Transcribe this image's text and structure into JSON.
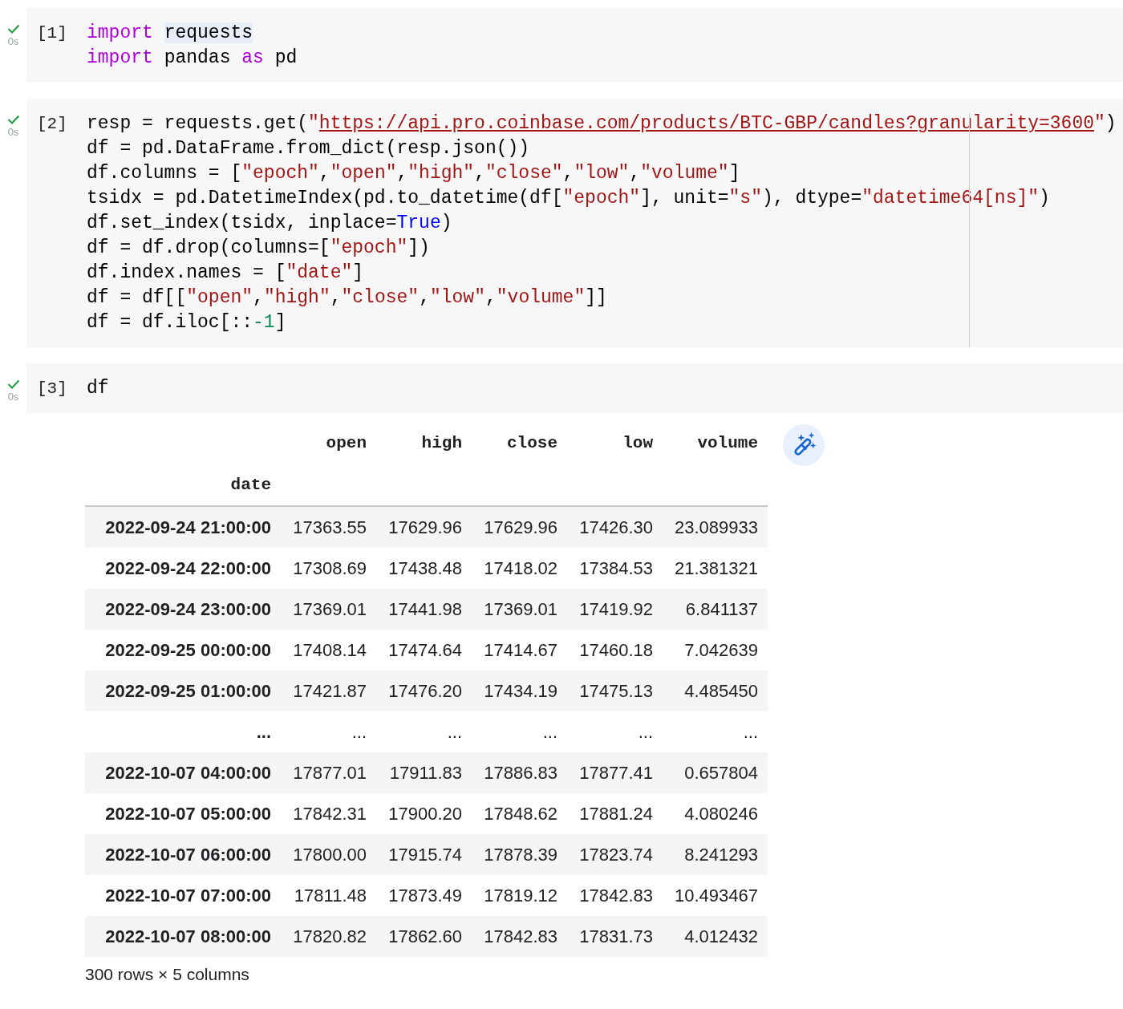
{
  "cells": [
    {
      "count": "[1]",
      "succeeded": true,
      "time": "0s",
      "lines": [
        [
          {
            "kind": "keyword",
            "text": "import "
          },
          {
            "kind": "match",
            "text": "requests"
          }
        ],
        [
          {
            "kind": "keyword",
            "text": "import"
          },
          {
            "kind": "plain",
            "text": " pandas "
          },
          {
            "kind": "keyword",
            "text": "as"
          },
          {
            "kind": "plain",
            "text": " pd"
          }
        ]
      ]
    },
    {
      "count": "[2]",
      "succeeded": true,
      "time": "0s",
      "lines": [
        [
          {
            "kind": "plain",
            "text": "resp = requests.get("
          },
          {
            "kind": "string",
            "text": "\""
          },
          {
            "kind": "link",
            "text": "https://api.pro.coinbase.com/products/BTC-GBP/candles?granularity=3600"
          },
          {
            "kind": "string",
            "text": "\""
          },
          {
            "kind": "plain",
            "text": ")"
          }
        ],
        [
          {
            "kind": "plain",
            "text": "df = pd.DataFrame.from_dict(resp.json())"
          }
        ],
        [
          {
            "kind": "plain",
            "text": "df.columns = ["
          },
          {
            "kind": "string",
            "text": "\"epoch\""
          },
          {
            "kind": "plain",
            "text": ","
          },
          {
            "kind": "string",
            "text": "\"open\""
          },
          {
            "kind": "plain",
            "text": ","
          },
          {
            "kind": "string",
            "text": "\"high\""
          },
          {
            "kind": "plain",
            "text": ","
          },
          {
            "kind": "string",
            "text": "\"close\""
          },
          {
            "kind": "plain",
            "text": ","
          },
          {
            "kind": "string",
            "text": "\"low\""
          },
          {
            "kind": "plain",
            "text": ","
          },
          {
            "kind": "string",
            "text": "\"volume\""
          },
          {
            "kind": "plain",
            "text": "]"
          }
        ],
        [
          {
            "kind": "plain",
            "text": "tsidx = pd.DatetimeIndex(pd.to_datetime(df["
          },
          {
            "kind": "string",
            "text": "\"epoch\""
          },
          {
            "kind": "plain",
            "text": "], unit="
          },
          {
            "kind": "string",
            "text": "\"s\""
          },
          {
            "kind": "plain",
            "text": "), dtype="
          },
          {
            "kind": "string",
            "text": "\"datetime64[ns]\""
          },
          {
            "kind": "plain",
            "text": ")"
          }
        ],
        [
          {
            "kind": "plain",
            "text": "df.set_index(tsidx, inplace="
          },
          {
            "kind": "constant",
            "text": "True"
          },
          {
            "kind": "plain",
            "text": ")"
          }
        ],
        [
          {
            "kind": "plain",
            "text": "df = df.drop(columns=["
          },
          {
            "kind": "string",
            "text": "\"epoch\""
          },
          {
            "kind": "plain",
            "text": "])"
          }
        ],
        [
          {
            "kind": "plain",
            "text": "df.index.names = ["
          },
          {
            "kind": "string",
            "text": "\"date\""
          },
          {
            "kind": "plain",
            "text": "]"
          }
        ],
        [
          {
            "kind": "plain",
            "text": "df = df[["
          },
          {
            "kind": "string",
            "text": "\"open\""
          },
          {
            "kind": "plain",
            "text": ","
          },
          {
            "kind": "string",
            "text": "\"high\""
          },
          {
            "kind": "plain",
            "text": ","
          },
          {
            "kind": "string",
            "text": "\"close\""
          },
          {
            "kind": "plain",
            "text": ","
          },
          {
            "kind": "string",
            "text": "\"low\""
          },
          {
            "kind": "plain",
            "text": ","
          },
          {
            "kind": "string",
            "text": "\"volume\""
          },
          {
            "kind": "plain",
            "text": "]]"
          }
        ],
        [
          {
            "kind": "plain",
            "text": "df = df.iloc[::"
          },
          {
            "kind": "number",
            "text": "-1"
          },
          {
            "kind": "plain",
            "text": "]"
          }
        ]
      ]
    },
    {
      "count": "[3]",
      "succeeded": true,
      "time": "0s",
      "lines": [
        [
          {
            "kind": "plain",
            "text": "df"
          }
        ]
      ]
    }
  ],
  "output": {
    "columns": [
      "open",
      "high",
      "close",
      "low",
      "volume"
    ],
    "index_name": "date",
    "rows": [
      {
        "index": "2022-09-24 21:00:00",
        "values": [
          "17363.55",
          "17629.96",
          "17629.96",
          "17426.30",
          "23.089933"
        ]
      },
      {
        "index": "2022-09-24 22:00:00",
        "values": [
          "17308.69",
          "17438.48",
          "17418.02",
          "17384.53",
          "21.381321"
        ]
      },
      {
        "index": "2022-09-24 23:00:00",
        "values": [
          "17369.01",
          "17441.98",
          "17369.01",
          "17419.92",
          "6.841137"
        ]
      },
      {
        "index": "2022-09-25 00:00:00",
        "values": [
          "17408.14",
          "17474.64",
          "17414.67",
          "17460.18",
          "7.042639"
        ]
      },
      {
        "index": "2022-09-25 01:00:00",
        "values": [
          "17421.87",
          "17476.20",
          "17434.19",
          "17475.13",
          "4.485450"
        ]
      },
      {
        "index": "...",
        "values": [
          "...",
          "...",
          "...",
          "...",
          "..."
        ]
      },
      {
        "index": "2022-10-07 04:00:00",
        "values": [
          "17877.01",
          "17911.83",
          "17886.83",
          "17877.41",
          "0.657804"
        ]
      },
      {
        "index": "2022-10-07 05:00:00",
        "values": [
          "17842.31",
          "17900.20",
          "17848.62",
          "17881.24",
          "4.080246"
        ]
      },
      {
        "index": "2022-10-07 06:00:00",
        "values": [
          "17800.00",
          "17915.74",
          "17878.39",
          "17823.74",
          "8.241293"
        ]
      },
      {
        "index": "2022-10-07 07:00:00",
        "values": [
          "17811.48",
          "17873.49",
          "17819.12",
          "17842.83",
          "10.493467"
        ]
      },
      {
        "index": "2022-10-07 08:00:00",
        "values": [
          "17820.82",
          "17862.60",
          "17842.83",
          "17831.73",
          "4.012432"
        ]
      }
    ],
    "footer": "300 rows × 5 columns"
  }
}
